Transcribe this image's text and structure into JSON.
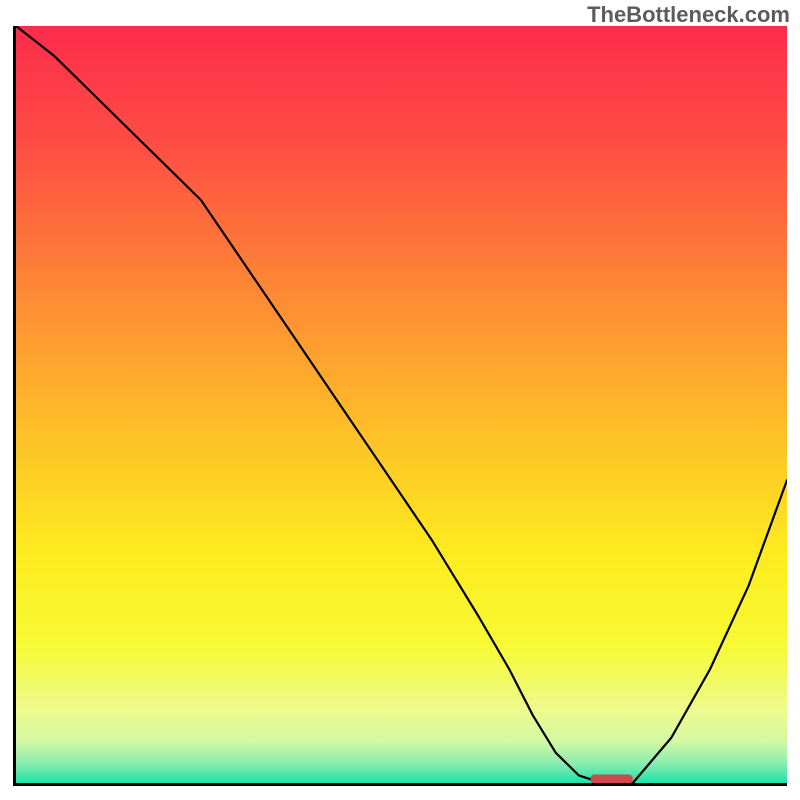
{
  "watermark": "TheBottleneck.com",
  "chart_data": {
    "type": "line",
    "title": "",
    "xlabel": "",
    "ylabel": "",
    "xlim": [
      0,
      100
    ],
    "ylim": [
      0,
      100
    ],
    "legend": false,
    "grid": false,
    "background_gradient": {
      "stops": [
        {
          "offset": 0.0,
          "color": "#fd2c4c"
        },
        {
          "offset": 0.16,
          "color": "#fe4e44"
        },
        {
          "offset": 0.34,
          "color": "#fd8535"
        },
        {
          "offset": 0.52,
          "color": "#fdbb28"
        },
        {
          "offset": 0.7,
          "color": "#fdec1f"
        },
        {
          "offset": 0.82,
          "color": "#f7fa35"
        },
        {
          "offset": 0.905,
          "color": "#edfa8e"
        },
        {
          "offset": 0.945,
          "color": "#d3f8a3"
        },
        {
          "offset": 0.975,
          "color": "#88edb0"
        },
        {
          "offset": 1.0,
          "color": "#1ee0a8"
        }
      ]
    },
    "series": [
      {
        "name": "bottleneck-curve",
        "x": [
          0,
          5,
          10,
          15,
          20,
          24,
          30,
          36,
          42,
          48,
          54,
          60,
          64,
          67,
          70,
          73,
          76,
          80,
          85,
          90,
          95,
          100
        ],
        "y": [
          100,
          96,
          91,
          86,
          81,
          77,
          68,
          59,
          50,
          41,
          32,
          22,
          15,
          9,
          4,
          1,
          0,
          0,
          6,
          15,
          26,
          40
        ]
      }
    ],
    "marker": {
      "name": "optimal-range-marker",
      "x_start": 74.5,
      "x_end": 80,
      "y": 0.6,
      "color": "#d0484e",
      "shape": "pill"
    }
  }
}
